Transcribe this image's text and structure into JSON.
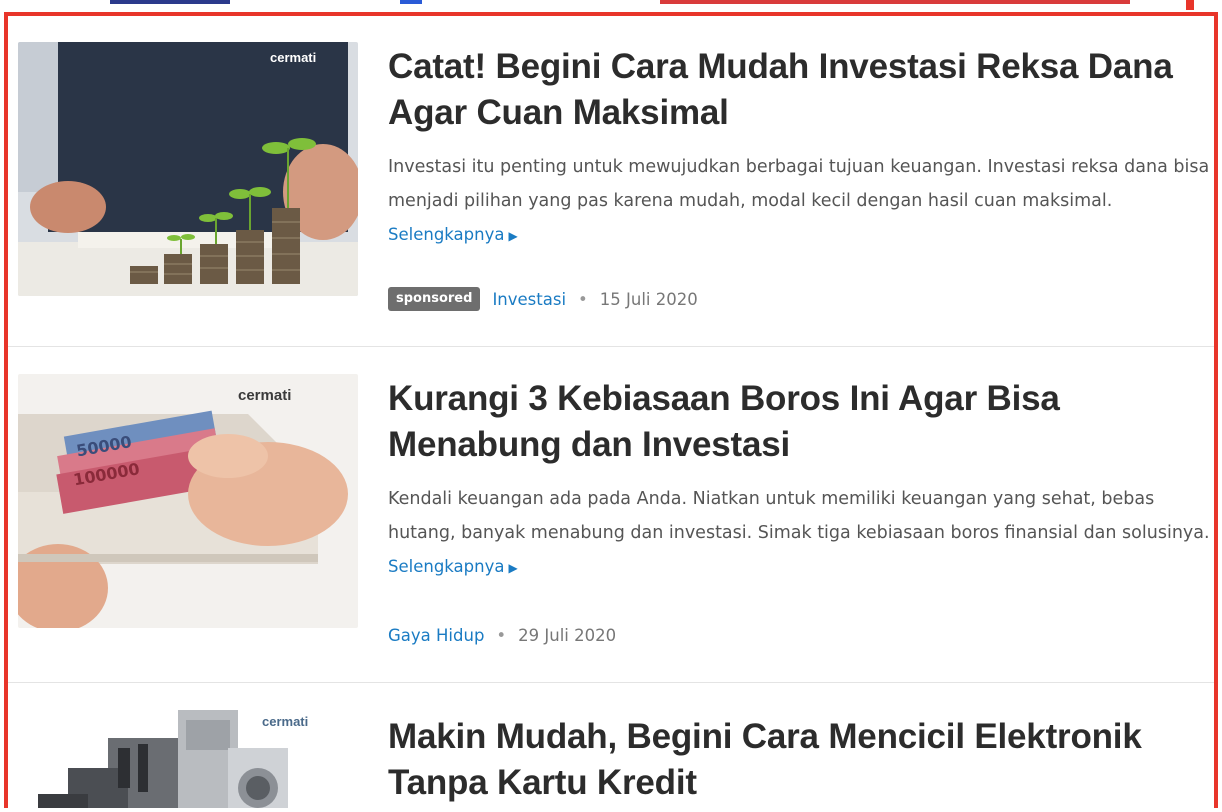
{
  "accent_colors": {
    "frame": "#e8352a",
    "link": "#1a7bc3",
    "badge_bg": "#6e6e6e"
  },
  "articles": [
    {
      "image_alt": "coin stacks with sprouts",
      "watermark": "cermati",
      "title": "Catat! Begini Cara Mudah Investasi Reksa Dana Agar Cuan Maksimal",
      "excerpt": "Investasi itu penting untuk mewujudkan berbagai tujuan keuangan. Investasi reksa dana bisa menjadi pilihan yang pas karena mudah, modal kecil dengan hasil cuan maksimal.",
      "read_more": "Selengkapnya",
      "badge": "sponsored",
      "category": "Investasi",
      "separator": "•",
      "date": "15 Juli 2020"
    },
    {
      "image_alt": "hand pulling money from wallet",
      "watermark": "cermati",
      "title": "Kurangi 3 Kebiasaan Boros Ini Agar Bisa Menabung dan Investasi",
      "excerpt": "Kendali keuangan ada pada Anda. Niatkan untuk memiliki keuangan yang sehat, bebas hutang, banyak menabung dan investasi. Simak tiga kebiasaan boros finansial dan solusinya.",
      "read_more": "Selengkapnya",
      "category": "Gaya Hidup",
      "separator": "•",
      "date": "29 Juli 2020"
    },
    {
      "image_alt": "electronic appliances",
      "watermark": "cermati",
      "title": "Makin Mudah, Begini Cara Mencicil Elektronik Tanpa Kartu Kredit"
    }
  ]
}
